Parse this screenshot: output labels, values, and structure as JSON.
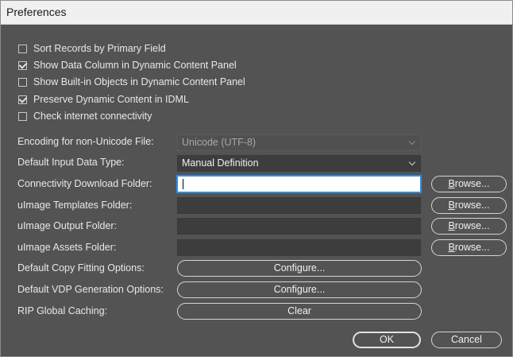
{
  "window": {
    "title": "Preferences"
  },
  "checkboxes": [
    {
      "label": "Sort Records by Primary Field",
      "checked": false
    },
    {
      "label": "Show Data Column in Dynamic Content Panel",
      "checked": true
    },
    {
      "label": "Show Built-in Objects in Dynamic Content Panel",
      "checked": false
    },
    {
      "label": "Preserve Dynamic Content in IDML",
      "checked": true
    },
    {
      "label": "Check internet connectivity",
      "checked": false
    }
  ],
  "encoding": {
    "label": "Encoding for non-Unicode File:",
    "value": "Unicode (UTF-8)"
  },
  "input_type": {
    "label": "Default Input Data Type:",
    "value": "Manual Definition"
  },
  "folders": {
    "connectivity": {
      "label": "Connectivity Download Folder:",
      "value": ""
    },
    "templates": {
      "label": "uImage Templates Folder:",
      "value": ""
    },
    "output": {
      "label": "uImage Output Folder:",
      "value": ""
    },
    "assets": {
      "label": "uImage Assets Folder:",
      "value": ""
    }
  },
  "browse": {
    "first": "B",
    "rest": "rowse..."
  },
  "copy_fitting": {
    "label": "Default Copy Fitting Options:",
    "button": "Configure..."
  },
  "vdp": {
    "label": "Default VDP Generation Options:",
    "button": "Configure..."
  },
  "rip": {
    "label": "RIP Global Caching:",
    "button": "Clear"
  },
  "footer": {
    "ok": "OK",
    "cancel": "Cancel"
  }
}
